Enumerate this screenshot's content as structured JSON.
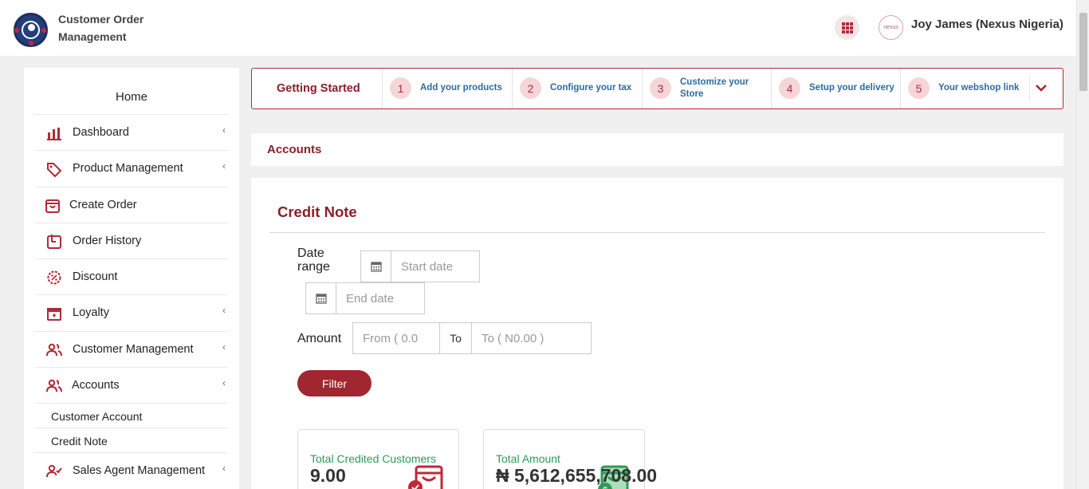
{
  "header": {
    "app_title": "Customer Order Management",
    "user_name": "Joy James (Nexus Nigeria)",
    "avatar_text": "nexus"
  },
  "sidebar": {
    "home": "Home",
    "items": [
      {
        "label": "Dashboard",
        "icon": "bar-chart-icon",
        "has_children": true
      },
      {
        "label": "Product Management",
        "icon": "tag-icon",
        "has_children": true
      },
      {
        "label": "Create Order",
        "icon": "shopping-bag-icon",
        "has_children": false
      },
      {
        "label": "Order History",
        "icon": "history-icon",
        "has_children": false
      },
      {
        "label": "Discount",
        "icon": "discount-badge-icon",
        "has_children": false
      },
      {
        "label": "Loyalty",
        "icon": "gift-box-icon",
        "has_children": true
      },
      {
        "label": "Customer Management",
        "icon": "users-icon",
        "has_children": true
      },
      {
        "label": "Accounts",
        "icon": "users-icon",
        "has_children": true
      }
    ],
    "sub_items": [
      "Customer Account",
      "Credit Note"
    ],
    "after_items": [
      {
        "label": "Sales Agent Management",
        "icon": "user-check-icon",
        "has_children": true
      }
    ]
  },
  "getting_started": {
    "title": "Getting Started",
    "steps": [
      {
        "num": "1",
        "label": "Add your products"
      },
      {
        "num": "2",
        "label": "Configure your tax"
      },
      {
        "num": "3",
        "label": "Customize your Store"
      },
      {
        "num": "4",
        "label": "Setup your delivery"
      },
      {
        "num": "5",
        "label": "Your webshop link"
      }
    ]
  },
  "breadcrumb": "Accounts",
  "credit_note": {
    "title": "Credit Note",
    "date_label": "Date range",
    "start_placeholder": "Start date",
    "end_placeholder": "End date",
    "amount_label": "Amount",
    "from_placeholder": "From ( 0.0",
    "to_label": "To",
    "to_placeholder": "To ( N0.00 )",
    "filter_label": "Filter"
  },
  "stats": [
    {
      "label": "Total Credited Customers",
      "value": "9.00"
    },
    {
      "label": "Total Amount",
      "value": "₦ 5,612,655,708.00"
    }
  ],
  "colors": {
    "brand": "#8b1f2b",
    "accent": "#a0262f",
    "link": "#2f6aa0",
    "success": "#2e9a55"
  }
}
